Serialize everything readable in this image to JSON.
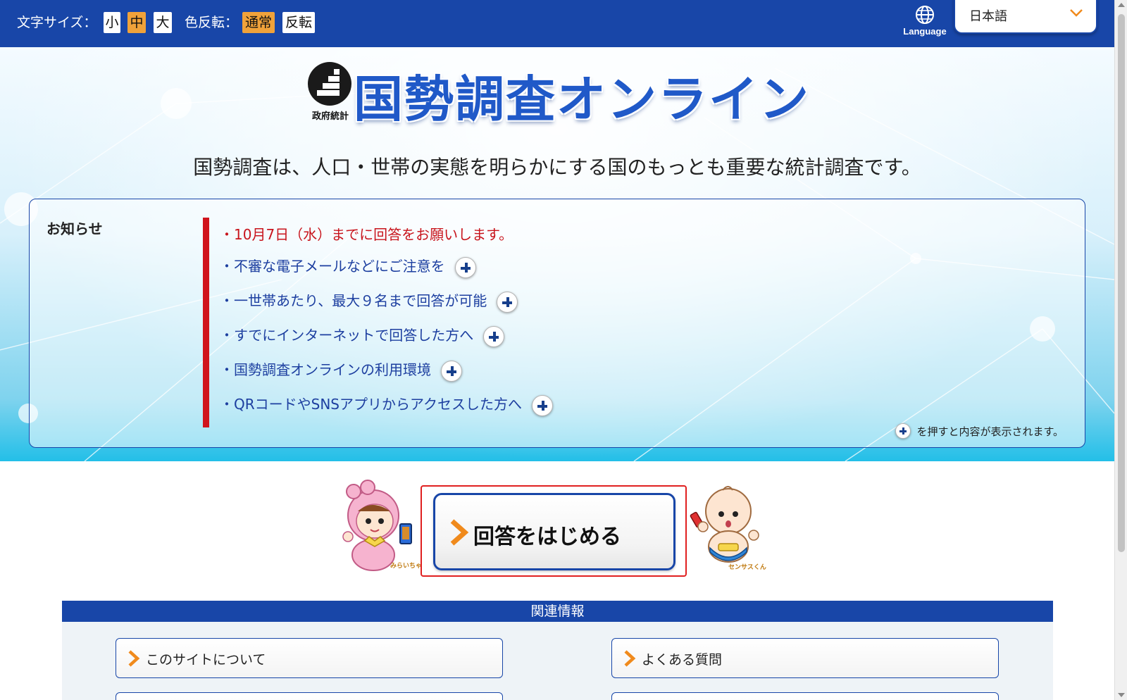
{
  "topbar": {
    "font_size_label": "文字サイズ：",
    "size_small": "小",
    "size_medium": "中",
    "size_large": "大",
    "invert_label": "色反転：",
    "mode_normal": "通常",
    "mode_invert": "反転",
    "language_label": "Language",
    "language_value": "日本語"
  },
  "logo": {
    "subtitle": "政府統計",
    "title": "国勢調査オンライン"
  },
  "tagline": "国勢調査は、人口・世帯の実態を明らかにする国のもっとも重要な統計調査です。",
  "notice": {
    "title": "お知らせ",
    "items": [
      {
        "text": "・10月7日（水）までに回答をお願いします。"
      },
      {
        "text": "・不審な電子メールなどにご注意を"
      },
      {
        "text": "・一世帯あたり、最大９名まで回答が可能"
      },
      {
        "text": "・すでにインターネットで回答した方へ"
      },
      {
        "text": "・国勢調査オンラインの利用環境"
      },
      {
        "text": "・QRコードやSNSアプリからアクセスした方へ"
      }
    ],
    "hint": "を押すと内容が表示されます。"
  },
  "start": {
    "label": "回答をはじめる",
    "mascot_left_name": "みらいちゃん",
    "mascot_right_name": "センサスくん"
  },
  "related": {
    "title": "関連情報",
    "links": [
      {
        "label": "このサイトについて"
      },
      {
        "label": "よくある質問"
      }
    ]
  },
  "colors": {
    "primary": "#1846a8",
    "accent_orange": "#f0a23a",
    "notice_red": "#c8141c",
    "link_blue": "#1d3fa0"
  }
}
